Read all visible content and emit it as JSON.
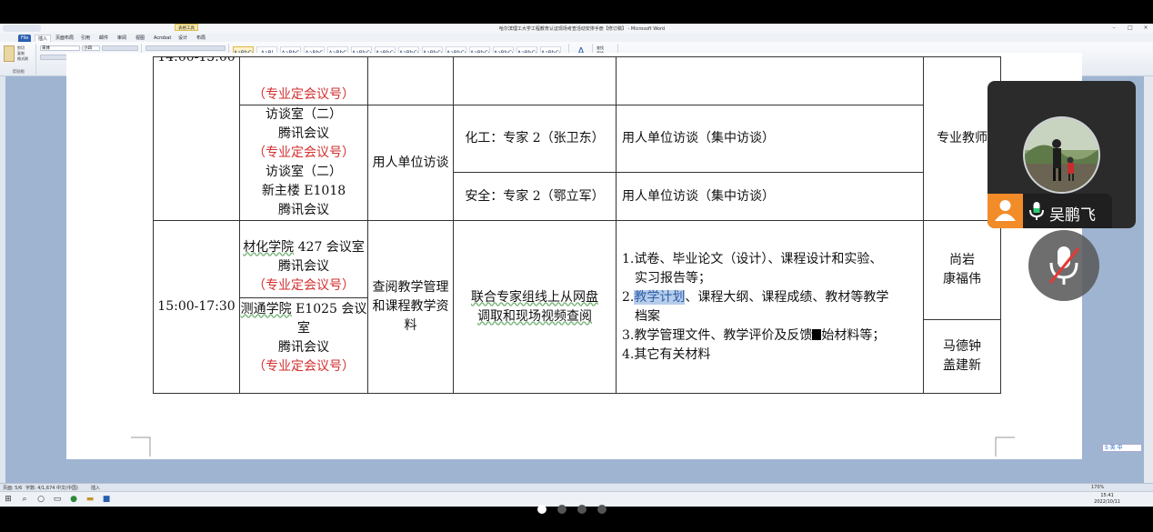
{
  "window": {
    "title": "哈尔滨理工大学工程教育认证现场考查活动安排手册【修订稿】 - Microsoft Word",
    "context_tab": "表格工具"
  },
  "ribbon": {
    "tabs": [
      "File",
      "插入",
      "页面布局",
      "引用",
      "邮件",
      "审阅",
      "视图",
      "Acrobat",
      "设计",
      "布局"
    ],
    "font_name": "宋体",
    "font_size": "小四",
    "clipboard_items": [
      "剪切",
      "复制",
      "格式刷"
    ],
    "styles": [
      {
        "preview": "AaBbCcI",
        "name": "正文"
      },
      {
        "preview": "AaBl",
        "name": "标题 1"
      },
      {
        "preview": "AaBbC",
        "name": "标题 2"
      },
      {
        "preview": "AaBbC",
        "name": "标题"
      },
      {
        "preview": "AaBbC",
        "name": "副标题"
      },
      {
        "preview": "AaBbCcI",
        "name": "不明显强调"
      },
      {
        "preview": "AaBbCcI",
        "name": "强调"
      },
      {
        "preview": "AaBbCcI",
        "name": "明显强调"
      },
      {
        "preview": "AaBbCcI",
        "name": "要点"
      },
      {
        "preview": "AaBbCcI",
        "name": "不明显参考"
      },
      {
        "preview": "AaBbCcI",
        "name": "明显参考"
      },
      {
        "preview": "AaBbCcI",
        "name": "书籍标题"
      },
      {
        "preview": "AaBbCcDd",
        "name": "无间隔"
      },
      {
        "preview": "AaBbCcDd",
        "name": "列表"
      }
    ],
    "change_styles": "更改样式",
    "editing": [
      "查找",
      "替换",
      "选择"
    ],
    "group_labels": [
      "剪贴板",
      "字体",
      "段落",
      "样式",
      "编辑"
    ]
  },
  "table": {
    "row1_time": "14:00-15:00",
    "row1_venue_a": "（专业定会议号）",
    "row1_venue_b": "访谈室（二）",
    "row1_venue_c": "腾讯会议",
    "row1_venue_d": "（专业定会议号）",
    "row1_venue_e": "访谈室（二）",
    "row1_venue_f": "新主楼 E1018",
    "row1_venue_g": "腾讯会议",
    "row1_activity": "用人单位访谈",
    "row1_expert_a": "化工：专家 2（张卫东）",
    "row1_content_a": "用人单位访谈（集中访谈）",
    "row1_expert_b": "安全：专家 2（鄂立军）",
    "row1_content_b": "用人单位访谈（集中访谈）",
    "row1_contact": "专业教师",
    "row2_time": "15:00-17:30",
    "row2_venue_a1": "材化学院",
    "row2_venue_a2": " 427 会议室",
    "row2_venue_a3": "腾讯会议",
    "row2_venue_a4": "（专业定会议号）",
    "row2_venue_b1": "测通学院",
    "row2_venue_b2": " E1025 会议室",
    "row2_venue_b3": "腾讯会议",
    "row2_venue_b4": "（专业定会议号）",
    "row2_activity": "查阅教学管理和课程教学资料",
    "row2_method_a": "联合专家组线上从网盘",
    "row2_method_b": "调取和现场视频查阅",
    "row2_list_1": "1.试卷、毕业论文（设计）、课程设计和实验、",
    "row2_list_1b": "实习报告等；",
    "row2_list_2_pre": "2.",
    "row2_list_2_hl": "教学计划",
    "row2_list_2_rest": "、课程大纲、课程成绩、教材等教学",
    "row2_list_2b": "档案",
    "row2_list_3_pre": "3.教学管理文件、教学评价及反馈",
    "row2_list_3_post": "始材料等；",
    "row2_list_4": "4.其它有关材料",
    "row2_contact_a1": "尚岩",
    "row2_contact_a2": "康福伟",
    "row2_contact_b1": "马德钟",
    "row2_contact_b2": "盖建新"
  },
  "statusbar": {
    "page": "页面: 5/6",
    "words": "字数: 4/1,674",
    "language": "中文(中国)",
    "mode": "插入",
    "zoom": "170%"
  },
  "meeting": {
    "participant_name": "吴鹏飞",
    "mic_state": "muted"
  },
  "taskbar": {
    "time": "15:41",
    "date": "2022/10/11"
  },
  "carousel": {
    "count": 4,
    "active": 0
  },
  "ime": {
    "label": "S 英 中"
  }
}
